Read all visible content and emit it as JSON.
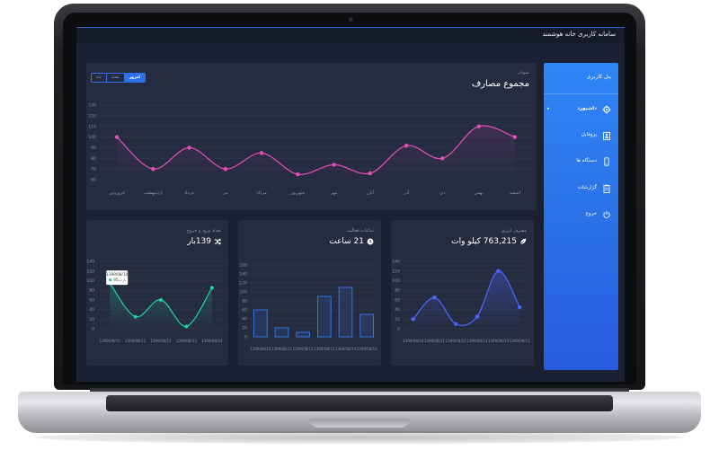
{
  "app": {
    "title": "سامانه کاربری خانه هوشمند"
  },
  "sidebar": {
    "title": "پنل کاربری",
    "items": [
      {
        "label": "داشبورد",
        "icon": "gear-icon",
        "active": true
      },
      {
        "label": "پروفایل",
        "icon": "profile-icon"
      },
      {
        "label": "دستگاه ها",
        "icon": "mobile-icon"
      },
      {
        "label": "گزارشات",
        "icon": "clipboard-icon"
      },
      {
        "label": "خروج",
        "icon": "power-icon"
      }
    ]
  },
  "main_chart": {
    "subtitle": "نمودار",
    "title": "مجموع مصارف",
    "tabs": [
      "ماه",
      "هفته",
      "امروز"
    ],
    "active_tab": "امروز"
  },
  "energy_card": {
    "subtitle": "مصرف انرژی",
    "value": "763,215 کیلو وات"
  },
  "activity_card": {
    "subtitle": "ساعات فعالیت",
    "value": "21 ساعت"
  },
  "entry_card": {
    "subtitle": "تعداد ورود و خروج",
    "value": "139بار",
    "tooltip": {
      "date": "1399/08/10",
      "label": "بازدید",
      "value": "95"
    }
  },
  "chart_data": [
    {
      "type": "line",
      "title": "مجموع مصارف",
      "categories": [
        "فروردین",
        "اردیبهشت",
        "خرداد",
        "تیر",
        "مرداد",
        "شهریور",
        "مهر",
        "آبان",
        "آذر",
        "دی",
        "بهمن",
        "اسفند"
      ],
      "series": [
        {
          "values": [
            100,
            70,
            90,
            70,
            85,
            65,
            74,
            66,
            92,
            80,
            110,
            100
          ]
        }
      ],
      "ylim": [
        80,
        130
      ],
      "yticks": [
        130,
        120,
        110,
        100,
        90,
        80,
        70,
        60
      ],
      "color": "#e44fb5"
    },
    {
      "type": "line",
      "title": "مصرف انرژی",
      "categories": [
        "1399/08/10",
        "1399/08/11",
        "1399/08/12",
        "1399/08/13",
        "1399/08/14",
        "1399/08/13"
      ],
      "series": [
        {
          "values": [
            20,
            65,
            10,
            25,
            120,
            45
          ]
        }
      ],
      "ylim": [
        0,
        140
      ],
      "yticks": [
        140,
        120,
        100,
        80,
        60,
        40,
        20,
        0
      ],
      "color": "#4a66ff"
    },
    {
      "type": "bar",
      "title": "ساعات فعالیت",
      "categories": [
        "1399/08/10",
        "1399/08/11",
        "1399/08/12",
        "1399/08/13",
        "1399/08/14",
        "1399/08/13"
      ],
      "values": [
        60,
        20,
        10,
        90,
        110,
        50
      ],
      "ylim": [
        0,
        160
      ],
      "yticks": [
        160,
        140,
        120,
        100,
        80,
        60,
        40,
        20,
        0
      ],
      "color": "#2f75e8"
    },
    {
      "type": "line",
      "title": "تعداد ورود و خروج",
      "categories": [
        "1399/08/10",
        "1399/08/11",
        "1399/08/12",
        "1399/08/13",
        "1399/08/14"
      ],
      "series": [
        {
          "values": [
            95,
            25,
            60,
            5,
            85
          ]
        }
      ],
      "ylim": [
        0,
        140
      ],
      "yticks": [
        140,
        120,
        100,
        80,
        60,
        40,
        20,
        0
      ],
      "color": "#1fd1b0"
    }
  ]
}
